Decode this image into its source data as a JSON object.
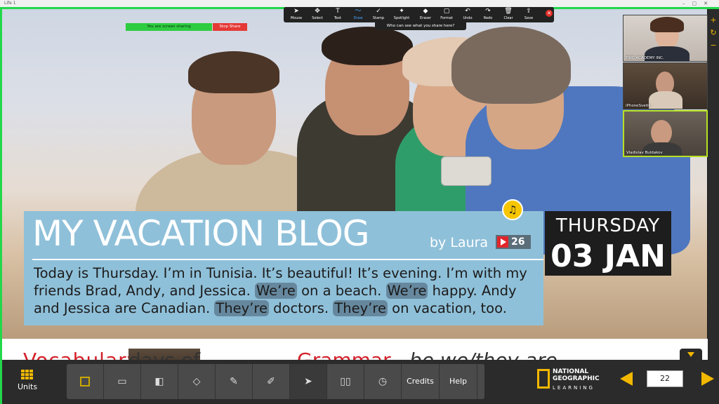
{
  "window": {
    "title": "Life 1"
  },
  "zoom_toolbar": {
    "tools": [
      {
        "label": "Mouse",
        "icon": "cursor-icon"
      },
      {
        "label": "Select",
        "icon": "move-icon"
      },
      {
        "label": "Text",
        "icon": "text-icon"
      },
      {
        "label": "Draw",
        "icon": "draw-icon"
      },
      {
        "label": "Stamp",
        "icon": "check-icon"
      },
      {
        "label": "Spotlight",
        "icon": "spotlight-icon"
      },
      {
        "label": "Eraser",
        "icon": "eraser-icon"
      },
      {
        "label": "Format",
        "icon": "format-icon"
      },
      {
        "label": "Undo",
        "icon": "undo-icon"
      },
      {
        "label": "Redo",
        "icon": "redo-icon"
      },
      {
        "label": "Clear",
        "icon": "trash-icon"
      },
      {
        "label": "Save",
        "icon": "save-icon"
      }
    ],
    "who_can_see": "Who can see what you share here?",
    "sharing_banner": "You are screen sharing",
    "stop_share": "Stop Share"
  },
  "participants": [
    {
      "name": "EWC ACADEMY INC."
    },
    {
      "name": "iPhoneSvetik"
    },
    {
      "name": "Vladislav Buldakov"
    }
  ],
  "blog": {
    "title": "MY VACATION BLOG",
    "byline": "by Laura",
    "track_number": "26",
    "text_parts": [
      "Today is Thursday. I’m in Tunisia. It’s beautiful! It’s evening. I’m with my friends Brad, Andy, and Jessica. ",
      "We’re",
      " on a beach. ",
      "We’re",
      " happy. Andy and Jessica are Canadian. ",
      "They’re",
      " doctors. ",
      "They’re",
      " on vacation, too."
    ]
  },
  "date_box": {
    "day": "THURSDAY",
    "date": "03 JAN"
  },
  "strip": {
    "vocab_heading": "Vocabulary",
    "vocab_sub": "days of",
    "grammar_heading": "Grammar",
    "grammar_sub": "be we/they are"
  },
  "bottom_bar": {
    "units_label": "Units",
    "tools": [
      {
        "icon": "worksheet-icon",
        "label": ""
      },
      {
        "icon": "presenter-icon",
        "label": ""
      },
      {
        "icon": "windows-icon",
        "label": ""
      },
      {
        "icon": "eraser-icon",
        "label": ""
      },
      {
        "icon": "pen-icon",
        "label": ""
      },
      {
        "icon": "highlighter-icon",
        "label": ""
      },
      {
        "icon": "cursor-icon",
        "label": ""
      },
      {
        "icon": "book-icon",
        "label": ""
      },
      {
        "icon": "timer-icon",
        "label": ""
      }
    ],
    "credits_label": "Credits",
    "help_label": "Help",
    "publisher_line1": "NATIONAL",
    "publisher_line2": "GEOGRAPHIC",
    "publisher_line3": "LEARNING",
    "page_number": "22"
  }
}
